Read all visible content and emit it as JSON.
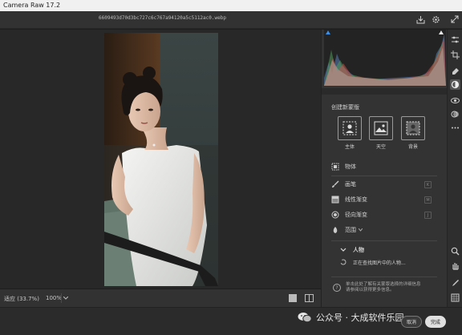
{
  "app": {
    "title": "Camera Raw 17.2"
  },
  "file": {
    "name": "6609493d70d3bc727c6c767a94120a5c5112ac0.webp"
  },
  "canvas": {
    "photo_alt": "Portrait photo of a woman in a white dress seated in a chair"
  },
  "bottombar": {
    "fit_label": "适应 (33.7%)",
    "zoom_value": "100%"
  },
  "panel": {
    "section_title": "创建新蒙版",
    "mask_types": [
      {
        "label": "主体",
        "icon": "person-icon"
      },
      {
        "label": "天空",
        "icon": "sky-icon"
      },
      {
        "label": "背景",
        "icon": "background-icon"
      }
    ],
    "tools": [
      {
        "label": "物体",
        "icon": "object-select-icon"
      },
      {
        "label": "画笔",
        "icon": "brush-icon"
      },
      {
        "label": "线性渐变",
        "icon": "linear-gradient-icon"
      },
      {
        "label": "径向渐变",
        "icon": "radial-gradient-icon"
      },
      {
        "label": "范围",
        "icon": "range-icon"
      }
    ],
    "people_header": "人物",
    "people_status": "正在查找图片中的人物...",
    "info_text_line1": "单击此处了解有关蒙版选择的详细信息",
    "info_text_line2": "请参阅以获得更多信息。"
  },
  "footer": {
    "watermark": "公众号 · 大成软件乐园",
    "cancel_label": "取消",
    "done_label": "完成"
  },
  "colors": {
    "accent": "#3a8ee6",
    "panel_bg": "#333333",
    "canvas_bg": "#282828"
  }
}
